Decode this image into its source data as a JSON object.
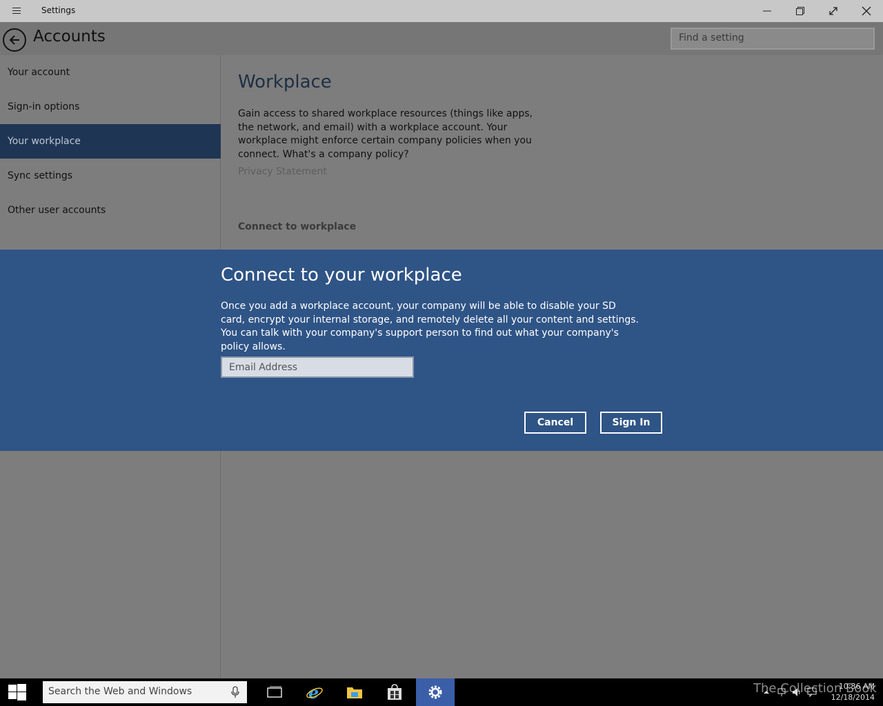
{
  "window": {
    "title": "Settings"
  },
  "header": {
    "title": "Accounts",
    "search_placeholder": "Find a setting"
  },
  "sidebar": {
    "items": [
      {
        "label": "Your account"
      },
      {
        "label": "Sign-in options"
      },
      {
        "label": "Your workplace",
        "active": true
      },
      {
        "label": "Sync settings"
      },
      {
        "label": "Other user accounts"
      }
    ]
  },
  "content": {
    "title": "Workplace",
    "description": "Gain access to shared workplace resources (things like apps, the network, and email) with a workplace account. Your workplace might enforce certain company policies when you connect. What's a company policy?",
    "privacy_link": "Privacy Statement",
    "connect_heading": "Connect to workplace"
  },
  "dialog": {
    "title": "Connect to your workplace",
    "body": "Once you add a workplace account, your company will be able to disable your SD card, encrypt your internal storage, and remotely delete all your content and settings.  You can talk with your company's support person to find out what your company's policy allows.",
    "email_placeholder": "Email Address",
    "cancel_label": "Cancel",
    "signin_label": "Sign In"
  },
  "taskbar": {
    "search_placeholder": "Search the Web and Windows",
    "time": "10:36 AM",
    "date": "12/18/2014",
    "watermark": "The Collection Book"
  },
  "colors": {
    "dialog_bg": "#2f5486",
    "nav_active_bg": "#1f3554",
    "page_bg": "#7d7d7d",
    "titlebar_bg": "#c8c8c8"
  }
}
